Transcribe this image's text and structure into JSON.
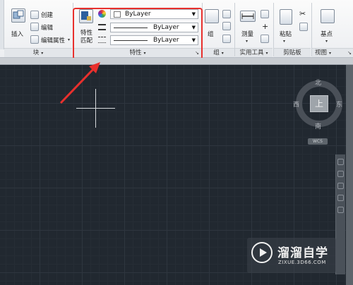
{
  "ribbon": {
    "block_panel": {
      "insert_label": "插入",
      "create_label": "创建",
      "edit_label": "编辑",
      "edit_attr_label": "编辑属性",
      "title": "块"
    },
    "properties_panel": {
      "match_label_line1": "特性",
      "match_label_line2": "匹配",
      "color_value": "ByLayer",
      "linetype_value": "ByLayer",
      "lineweight_value": "ByLayer",
      "title": "特性"
    },
    "group_panel": {
      "group_label": "组",
      "title": "组"
    },
    "utilities_panel": {
      "measure_label": "测量",
      "title": "实用工具"
    },
    "clipboard_panel": {
      "paste_label": "粘贴",
      "title": "剪贴板"
    },
    "view_panel": {
      "basepoint_label": "基点",
      "title": "视图"
    }
  },
  "viewcube": {
    "north": "北",
    "south": "南",
    "east": "东",
    "west": "西",
    "top": "上",
    "wcs": "WCS"
  },
  "watermark": {
    "title": "溜溜自学",
    "url": "ZIXUE.3D66.COM"
  },
  "colors": {
    "highlight": "#e8302d",
    "canvas": "#212830"
  }
}
